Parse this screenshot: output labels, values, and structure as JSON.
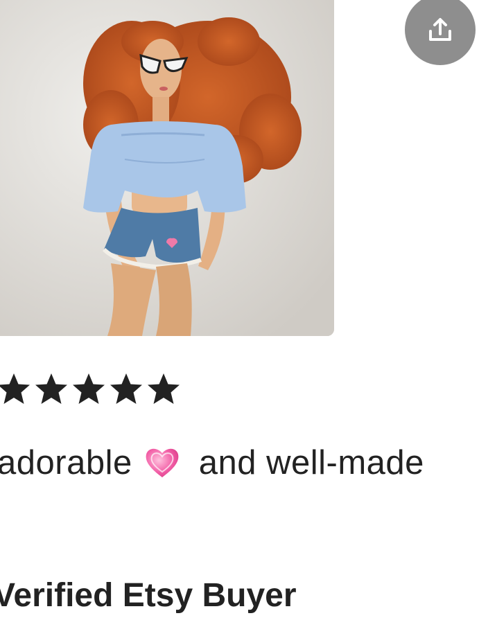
{
  "review": {
    "rating": 5,
    "rating_max": 5,
    "text_before": "adorable",
    "emoji": "heart-emoji",
    "text_after": "and well-made",
    "reviewer": "Verified Etsy Buyer"
  },
  "share": {
    "icon": "share-icon"
  },
  "colors": {
    "share_bg": "#8e8e8e",
    "star": "#222222",
    "text": "#222222"
  }
}
